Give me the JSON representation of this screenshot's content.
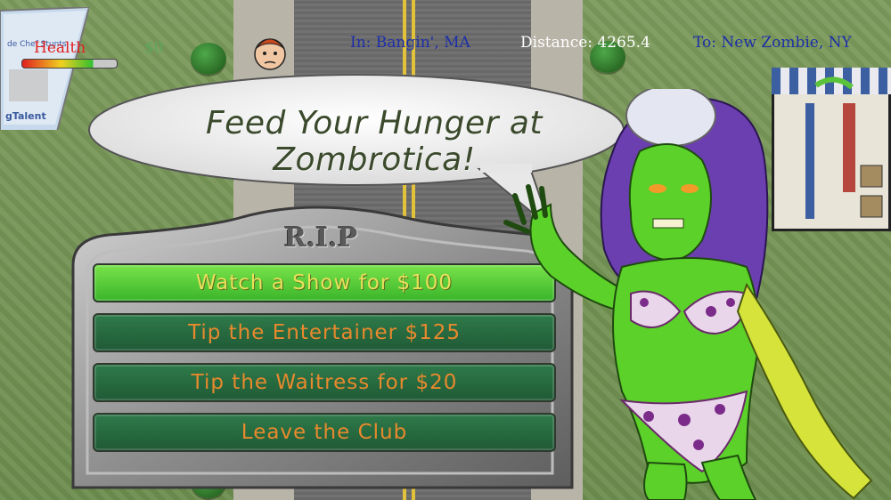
{
  "hud": {
    "health_label": "Health",
    "health_fraction": 0.75,
    "money": "$0",
    "location": "In: Bangin', MA",
    "distance": "Distance: 4265.4",
    "destination": "To: New Zombie, NY"
  },
  "bubble": {
    "text": "Feed Your Hunger at Zombrotica!"
  },
  "menu": {
    "title": "R.I.P",
    "options": [
      {
        "label": "Watch a Show for $100",
        "active": true
      },
      {
        "label": "Tip the Entertainer $125",
        "active": false
      },
      {
        "label": "Tip the Waitress for $20",
        "active": false
      },
      {
        "label": "Leave the Club",
        "active": false
      }
    ]
  },
  "billboard": {
    "text_top": "de Chef Stunts",
    "text_bottom": "gTalent"
  },
  "colors": {
    "hud_blue": "#1d2fa8",
    "health_red": "#e02020",
    "money_green": "#5ba85b",
    "button_active": "#5ccc3a",
    "button_normal": "#276a40",
    "button_text": "#e8892d"
  }
}
